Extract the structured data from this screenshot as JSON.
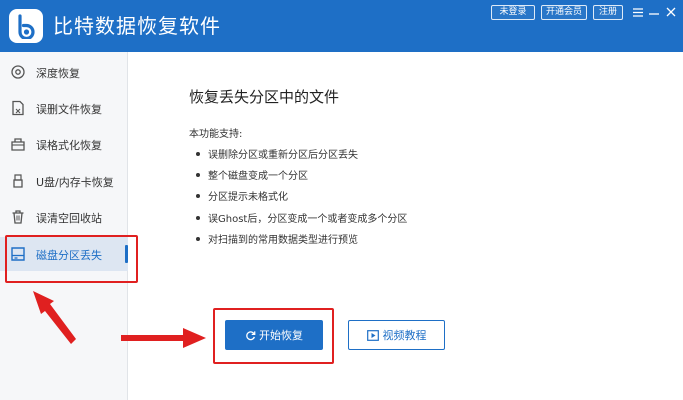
{
  "app": {
    "title": "比特数据恢复软件",
    "accent_color": "#1e6fc6",
    "logo_icon": "bitdata-logo-icon"
  },
  "topbar": {
    "login_label": "未登录",
    "vip_label": "开通会员",
    "register_label": "注册",
    "menu_icon": "menu-icon",
    "minimize_icon": "minimize-icon",
    "close_icon": "close-icon"
  },
  "sidebar": {
    "items": [
      {
        "label": "深度恢复",
        "icon": "deep-recovery-icon"
      },
      {
        "label": "误删文件恢复",
        "icon": "deleted-file-icon"
      },
      {
        "label": "误格式化恢复",
        "icon": "format-recovery-icon"
      },
      {
        "label": "U盘/内存卡恢复",
        "icon": "usb-drive-icon"
      },
      {
        "label": "误清空回收站",
        "icon": "recycle-bin-icon"
      },
      {
        "label": "磁盘分区丢失",
        "icon": "disk-partition-icon"
      }
    ],
    "active_index": 5
  },
  "main": {
    "title": "恢复丢失分区中的文件",
    "support_label": "本功能支持:",
    "features": [
      "误删除分区或重新分区后分区丢失",
      "整个磁盘变成一个分区",
      "分区提示未格式化",
      "误Ghost后，分区变成一个或者变成多个分区",
      "对扫描到的常用数据类型进行预览"
    ],
    "start_button": "开始恢复",
    "video_button": "视频教程"
  },
  "annotations": {
    "highlight_color": "#e02020",
    "arrows": 2
  }
}
